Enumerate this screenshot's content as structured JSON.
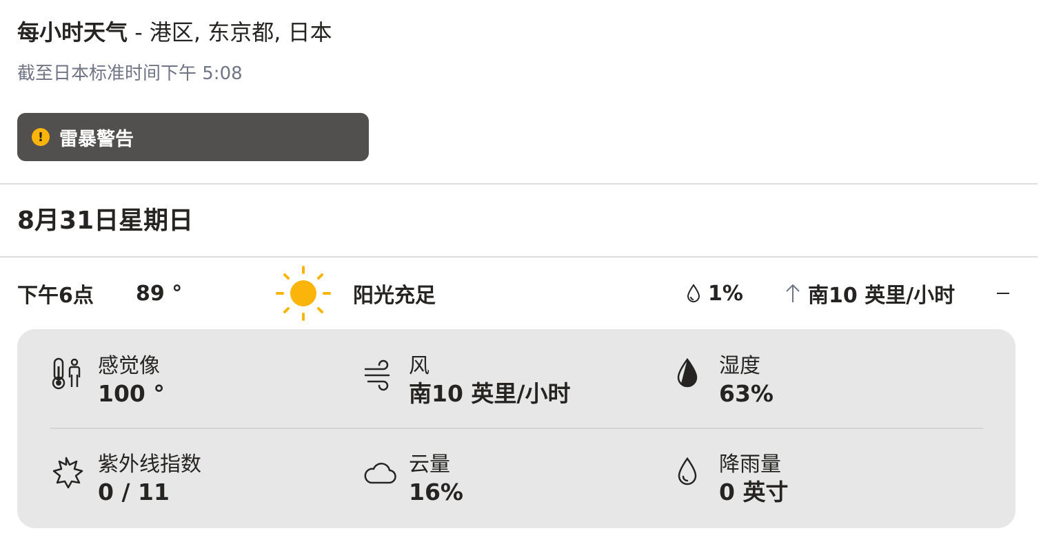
{
  "header": {
    "title": "每小时天气",
    "separator": " - ",
    "location": "港区, 东京都, 日本",
    "as_of": "截至日本标准时间下午 5:08"
  },
  "alert": {
    "icon": "alert-icon",
    "icon_glyph": "!",
    "label": "雷暴警告",
    "colors": {
      "background": "#52504e",
      "icon": "#fbb40a"
    }
  },
  "day": {
    "heading": "8月31日星期日"
  },
  "hour": {
    "time": "下午6点",
    "temperature": "89 °",
    "condition_icon": "sun-icon",
    "condition": "阳光充足",
    "precip_chance": "1%",
    "wind": "南10 英里/小时",
    "collapse_icon": "minus-icon"
  },
  "details": [
    {
      "icon": "thermometer-person-icon",
      "label": "感觉像",
      "value": "100 °"
    },
    {
      "icon": "wind-icon",
      "label": "风",
      "value": "南10 英里/小时"
    },
    {
      "icon": "humidity-drop-icon",
      "label": "湿度",
      "value": "63%"
    },
    {
      "icon": "uv-sun-icon",
      "label": "紫外线指数",
      "value": "0 / 11"
    },
    {
      "icon": "cloud-icon",
      "label": "云量",
      "value": "16%"
    },
    {
      "icon": "rain-drop-icon",
      "label": "降雨量",
      "value": "0 英寸"
    }
  ],
  "colors": {
    "text": "#252422",
    "muted_text": "#6f7585",
    "sun": "#fbb40a",
    "panel": "#e7e7e7"
  }
}
